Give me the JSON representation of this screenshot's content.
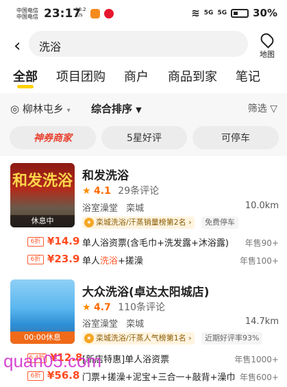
{
  "status_bar": {
    "carrier1": "中国电信",
    "carrier2": "中国电信",
    "time": "23:17",
    "speed_value": "10.2",
    "speed_unit": "K/s",
    "network1": "5G",
    "network2": "5G",
    "battery": "30%"
  },
  "search": {
    "query": "洗浴",
    "map_label": "地图"
  },
  "tabs": [
    "全部",
    "项目团购",
    "商户",
    "商品到家",
    "笔记"
  ],
  "filters": {
    "location": "柳林屯乡",
    "sort": "综合排序",
    "filter": "筛选"
  },
  "chips": [
    "神券商家",
    "5星好评",
    "可停车"
  ],
  "listings": [
    {
      "name": "和发洗浴",
      "sign_text": "和发洗浴",
      "score": "4.1",
      "reviews": "29条评论",
      "category": "浴室澡堂",
      "area": "栾城",
      "distance": "10.0km",
      "status": "休息中",
      "rank": "栾城洗浴/汗蒸销量榜第2名",
      "extra_badge": "免费停车",
      "deals": [
        {
          "discount": "6折",
          "price": "¥14.9",
          "title": "单人浴资票(含毛巾+洗发露+沐浴露)",
          "sold": "年售90+"
        },
        {
          "discount": "6折",
          "price": "¥23.9",
          "title_before": "单人",
          "title_highlight": "洗浴",
          "title_after": "+搓澡",
          "sold": "年售100+"
        }
      ]
    },
    {
      "name": "大众洗浴(卓达太阳城店)",
      "score": "4.7",
      "reviews": "110条评论",
      "category": "浴室澡堂",
      "area": "栾城",
      "distance": "14.7km",
      "status": "00:00休息",
      "rank": "栾城洗浴/汗蒸人气榜第1名",
      "extra_badge": "近期好评率93%",
      "deals": [
        {
          "discount": "6.4折",
          "price": "¥12.8",
          "title": "[新店特惠]单人浴资票",
          "sold": "年售1000+"
        },
        {
          "discount": "6折",
          "price": "¥56.8",
          "title": "门票+搓澡+泥宝+三合一+敲背+澡巾",
          "sold": "年售600+"
        }
      ]
    }
  ],
  "watermark": "quan05.com",
  "colors": {
    "accent": "#ffd100",
    "price": "#ff4a1f",
    "special_chip": "#e9412e"
  }
}
